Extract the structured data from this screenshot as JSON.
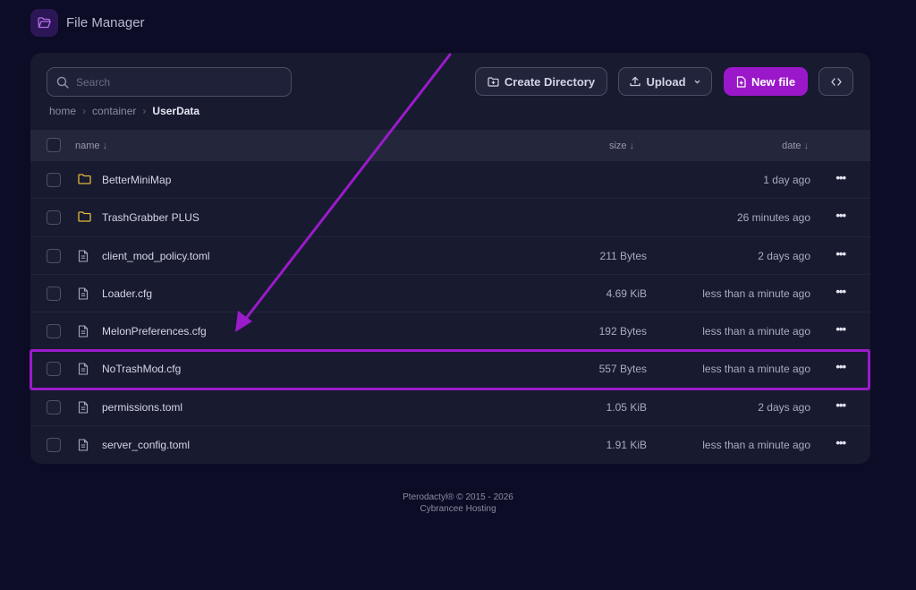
{
  "app": {
    "title": "File Manager",
    "icon": "folder-open-icon"
  },
  "toolbar": {
    "search_placeholder": "Search",
    "create_directory": "Create Directory",
    "upload": "Upload",
    "new_file": "New file",
    "code_icon": "code-icon"
  },
  "breadcrumb": {
    "home": "home",
    "container": "container",
    "current": "UserData"
  },
  "table": {
    "col_name": "name",
    "col_size": "size",
    "col_date": "date",
    "sort_arrow": "↓",
    "rows": [
      {
        "type": "folder",
        "name": "BetterMiniMap",
        "size": "",
        "date": "1 day ago"
      },
      {
        "type": "folder",
        "name": "TrashGrabber PLUS",
        "size": "",
        "date": "26 minutes ago"
      },
      {
        "type": "file",
        "name": "client_mod_policy.toml",
        "size": "211 Bytes",
        "date": "2 days ago"
      },
      {
        "type": "file",
        "name": "Loader.cfg",
        "size": "4.69 KiB",
        "date": "less than a minute ago"
      },
      {
        "type": "file",
        "name": "MelonPreferences.cfg",
        "size": "192 Bytes",
        "date": "less than a minute ago"
      },
      {
        "type": "file",
        "name": "NoTrashMod.cfg",
        "size": "557 Bytes",
        "date": "less than a minute ago",
        "highlighted": true
      },
      {
        "type": "file",
        "name": "permissions.toml",
        "size": "1.05 KiB",
        "date": "2 days ago"
      },
      {
        "type": "file",
        "name": "server_config.toml",
        "size": "1.91 KiB",
        "date": "less than a minute ago"
      }
    ],
    "row_menu": "•••"
  },
  "footer": {
    "line1": "Pterodactyl® © 2015 - 2026",
    "line2": "Cybrancee Hosting"
  },
  "colors": {
    "accent": "#9a18c9",
    "background": "#0c0c26",
    "panel": "#181a30",
    "folder": "#e2b93b"
  }
}
